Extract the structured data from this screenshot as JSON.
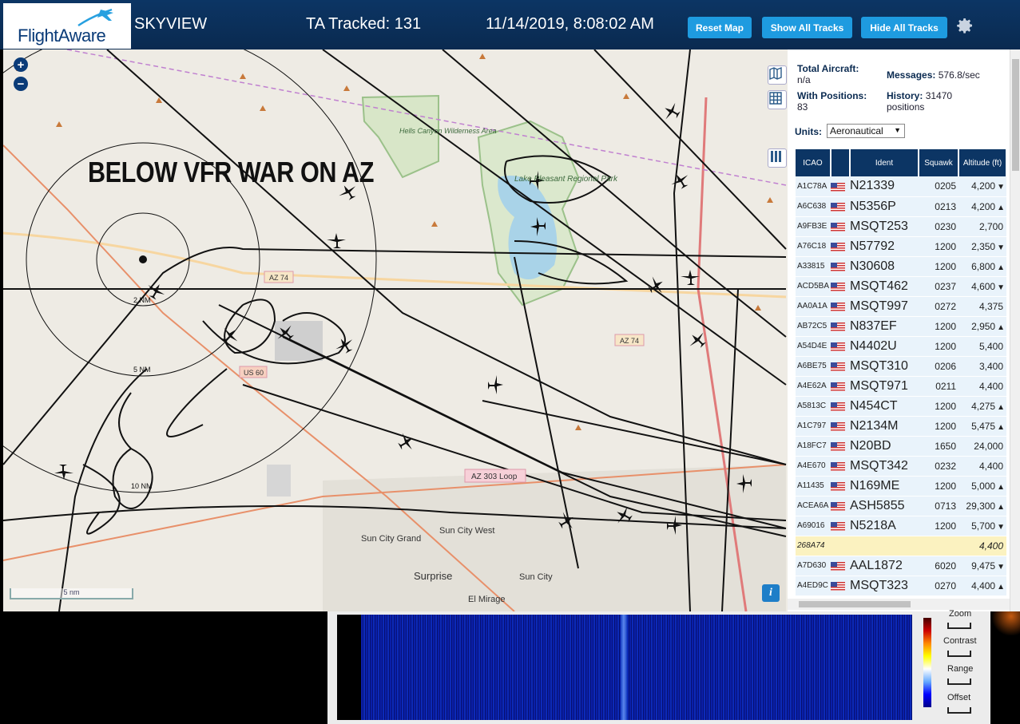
{
  "header": {
    "logo_text": "FlightAware",
    "title": "SKYVIEW",
    "tracked": "TA Tracked: 131",
    "datetime": "11/14/2019, 8:08:02 AM",
    "buttons": {
      "reset": "Reset Map",
      "show": "Show All Tracks",
      "hide": "Hide All Tracks"
    },
    "settings_icon": "gear-icon"
  },
  "map": {
    "banner": "BELOW VFR WAR ON AZ",
    "zoom_in": "+",
    "zoom_out": "−",
    "scale": "5 nm",
    "info": "i",
    "range_rings": [
      "2 NM",
      "5 NM",
      "10 NM"
    ],
    "place_labels": {
      "hells_canyon": "Hells Canyon Wilderness Area",
      "lake": "Lake Pleasant Regional Park",
      "sun_city_grand": "Sun City Grand",
      "sun_city_west": "Sun City West",
      "surprise": "Surprise",
      "sun_city": "Sun City",
      "el_mirage": "El Mirage"
    },
    "road_labels": {
      "az74_a": "AZ 74",
      "az74_b": "AZ 74",
      "us60": "US 60",
      "az303": "AZ 303 Loop"
    }
  },
  "sidebar": {
    "total_aircraft_label": "Total Aircraft:",
    "total_aircraft_value": "n/a",
    "messages_label": "Messages:",
    "messages_value": "576.8/sec",
    "with_positions_label": "With Positions:",
    "with_positions_value": "83",
    "history_label": "History:",
    "history_value": "31470",
    "history_unit": "positions",
    "units_label": "Units:",
    "units_value": "Aeronautical",
    "columns": [
      "ICAO",
      "",
      "Ident",
      "Squawk",
      "Altitude (ft)"
    ],
    "rows": [
      {
        "icao": "A1C78A",
        "ident": "N21339",
        "squawk": "0205",
        "alt": "4,200",
        "trend": "▼"
      },
      {
        "icao": "A6C638",
        "ident": "N5356P",
        "squawk": "0213",
        "alt": "4,200",
        "trend": "▲"
      },
      {
        "icao": "A9FB3E",
        "ident": "MSQT253",
        "squawk": "0230",
        "alt": "2,700",
        "trend": ""
      },
      {
        "icao": "A76C18",
        "ident": "N57792",
        "squawk": "1200",
        "alt": "2,350",
        "trend": "▼"
      },
      {
        "icao": "A33815",
        "ident": "N30608",
        "squawk": "1200",
        "alt": "6,800",
        "trend": "▲"
      },
      {
        "icao": "ACD5BA",
        "ident": "MSQT462",
        "squawk": "0237",
        "alt": "4,600",
        "trend": "▼"
      },
      {
        "icao": "AA0A1A",
        "ident": "MSQT997",
        "squawk": "0272",
        "alt": "4,375",
        "trend": ""
      },
      {
        "icao": "AB72C5",
        "ident": "N837EF",
        "squawk": "1200",
        "alt": "2,950",
        "trend": "▲"
      },
      {
        "icao": "A54D4E",
        "ident": "N4402U",
        "squawk": "1200",
        "alt": "5,400",
        "trend": ""
      },
      {
        "icao": "A6BE75",
        "ident": "MSQT310",
        "squawk": "0206",
        "alt": "3,400",
        "trend": ""
      },
      {
        "icao": "A4E62A",
        "ident": "MSQT971",
        "squawk": "0211",
        "alt": "4,400",
        "trend": ""
      },
      {
        "icao": "A5813C",
        "ident": "N454CT",
        "squawk": "1200",
        "alt": "4,275",
        "trend": "▲"
      },
      {
        "icao": "A1C797",
        "ident": "N2134M",
        "squawk": "1200",
        "alt": "5,475",
        "trend": "▲"
      },
      {
        "icao": "A18FC7",
        "ident": "N20BD",
        "squawk": "1650",
        "alt": "24,000",
        "trend": ""
      },
      {
        "icao": "A4E670",
        "ident": "MSQT342",
        "squawk": "0232",
        "alt": "4,400",
        "trend": ""
      },
      {
        "icao": "A11435",
        "ident": "N169ME",
        "squawk": "1200",
        "alt": "5,000",
        "trend": "▲"
      },
      {
        "icao": "ACEA6A",
        "ident": "ASH5855",
        "squawk": "0713",
        "alt": "29,300",
        "trend": "▲"
      },
      {
        "icao": "A69016",
        "ident": "N5218A",
        "squawk": "1200",
        "alt": "5,700",
        "trend": "▼"
      },
      {
        "icao": "268A74",
        "ident": "",
        "squawk": "",
        "alt": "4,400",
        "trend": "",
        "highlight": true,
        "noflag": true
      },
      {
        "icao": "A7D630",
        "ident": "AAL1872",
        "squawk": "6020",
        "alt": "9,475",
        "trend": "▼"
      },
      {
        "icao": "A4ED9C",
        "ident": "MSQT323",
        "squawk": "0270",
        "alt": "4,400",
        "trend": "▲"
      }
    ]
  },
  "spectrum": {
    "labels": {
      "zoom": "Zoom",
      "contrast": "Contrast",
      "range": "Range",
      "offset": "Offset"
    }
  },
  "colors": {
    "header_bg": "#0c3564",
    "button": "#1e9be0",
    "table_header": "#0c3564",
    "row_bg": "#e9f3fb",
    "highlight_row": "#fbf2c0"
  }
}
